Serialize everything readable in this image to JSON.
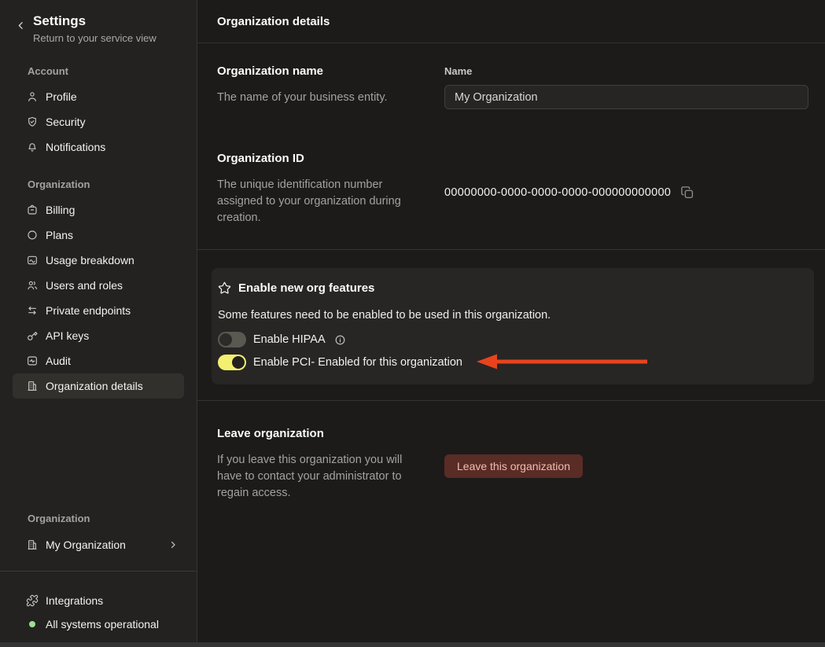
{
  "colors": {
    "toggle_on": "#f3ef70",
    "arrow": "#e8431d",
    "status_ok": "#9ddf94",
    "leave_button_bg": "#5a2c26",
    "leave_button_text": "#f2bcae"
  },
  "sidebar": {
    "back_title": "Settings",
    "back_subtitle": "Return to your service view",
    "account_label": "Account",
    "account_items": [
      {
        "label": "Profile",
        "icon": "user-icon"
      },
      {
        "label": "Security",
        "icon": "shield-check-icon"
      },
      {
        "label": "Notifications",
        "icon": "bell-icon"
      }
    ],
    "organization_label": "Organization",
    "organization_items": [
      {
        "label": "Billing",
        "icon": "billing-icon",
        "selected": false
      },
      {
        "label": "Plans",
        "icon": "circle-icon",
        "selected": false
      },
      {
        "label": "Usage breakdown",
        "icon": "usage-chart-icon",
        "selected": false
      },
      {
        "label": "Users and roles",
        "icon": "users-icon",
        "selected": false
      },
      {
        "label": "Private endpoints",
        "icon": "swap-arrows-icon",
        "selected": false
      },
      {
        "label": "API keys",
        "icon": "key-icon",
        "selected": false
      },
      {
        "label": "Audit",
        "icon": "activity-icon",
        "selected": false
      },
      {
        "label": "Organization details",
        "icon": "building-icon",
        "selected": true
      }
    ],
    "bottom_organization_label": "Organization",
    "current_org": "My Organization",
    "integrations_label": "Integrations",
    "status_label": "All systems operational"
  },
  "main": {
    "header_title": "Organization details",
    "org_name_section": {
      "title": "Organization name",
      "description": "The name of your business entity.",
      "field_label": "Name",
      "field_value": "My Organization"
    },
    "org_id_section": {
      "title": "Organization ID",
      "description": "The unique identification number assigned to your organization during creation.",
      "value": "00000000-0000-0000-0000-000000000000"
    },
    "features_card": {
      "title": "Enable new org features",
      "description": "Some features need to be enabled to be used in this organization.",
      "toggles": [
        {
          "label": "Enable HIPAA",
          "enabled": false,
          "has_info": true
        },
        {
          "label": "Enable PCI- Enabled for this organization",
          "enabled": true,
          "has_info": false
        }
      ]
    },
    "leave_section": {
      "title": "Leave organization",
      "description": "If you leave this organization you will have to contact your administrator to regain access.",
      "button_label": "Leave this organization"
    }
  }
}
